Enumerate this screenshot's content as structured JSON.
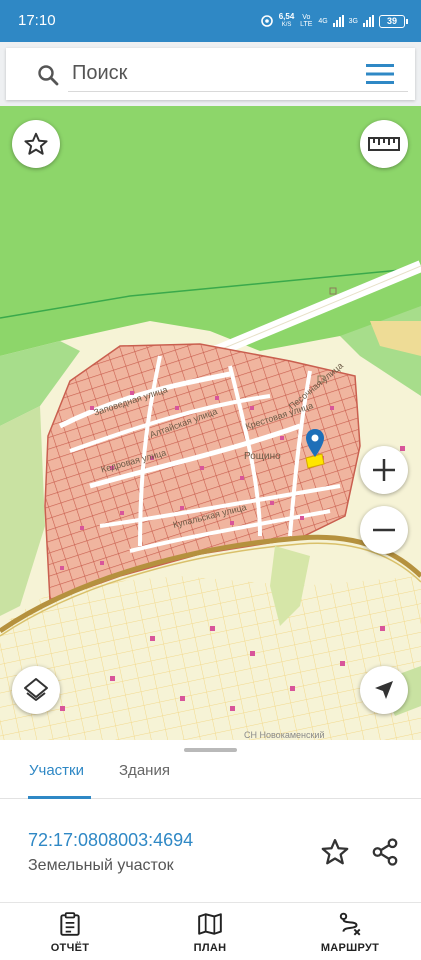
{
  "status_bar": {
    "time": "17:10",
    "net_speed": "6,54",
    "net_unit": "K/S",
    "vo_lte": "Vo LTE",
    "net_4g": "4G",
    "net_3g": "3G",
    "battery": "39"
  },
  "search": {
    "placeholder": "Поиск"
  },
  "map": {
    "street_labels": [
      "Заповедная улица",
      "Алтайская улица",
      "Кедровая улица",
      "Крестовая улица",
      "Песочная улица",
      "Купальская улица"
    ],
    "place_label": "Рощино",
    "district_label": "СН Новокаменский",
    "colors": {
      "forest": "#8dd66a",
      "plots": "#f0b59f",
      "plot_lines": "#c95f4f",
      "field": "#f6f3d6",
      "road": "#b5913e"
    }
  },
  "sheet": {
    "tabs": [
      {
        "label": "Участки",
        "active": true
      },
      {
        "label": "Здания",
        "active": false
      }
    ],
    "cadastral_number": "72:17:0808003:4694",
    "parcel_type": "Земельный участок"
  },
  "bottom_nav": [
    {
      "label": "ОТЧЁТ",
      "icon": "clipboard-icon"
    },
    {
      "label": "ПЛАН",
      "icon": "map-icon"
    },
    {
      "label": "МАРШРУТ",
      "icon": "route-icon"
    }
  ],
  "accent_color": "#2f88c5"
}
